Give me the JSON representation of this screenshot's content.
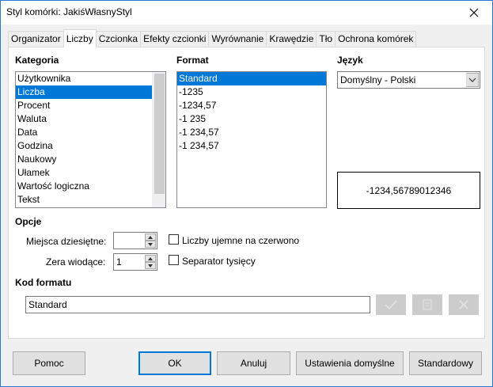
{
  "window": {
    "title": "Styl komórki: JakiśWłasnyStyl"
  },
  "tabs": [
    {
      "label": "Organizator"
    },
    {
      "label": "Liczby",
      "active": true
    },
    {
      "label": "Czcionka"
    },
    {
      "label": "Efekty czcionki"
    },
    {
      "label": "Wyrównanie"
    },
    {
      "label": "Krawędzie"
    },
    {
      "label": "Tło"
    },
    {
      "label": "Ochrona komórek"
    }
  ],
  "category": {
    "label": "Kategoria",
    "items": [
      "Użytkownika",
      "Liczba",
      "Procent",
      "Waluta",
      "Data",
      "Godzina",
      "Naukowy",
      "Ułamek",
      "Wartość logiczna",
      "Tekst"
    ],
    "selected": "Liczba"
  },
  "format": {
    "label": "Format",
    "items": [
      "Standard",
      "-1235",
      "-1234,57",
      "-1 235",
      "-1 234,57",
      "-1 234,57"
    ],
    "selected": "Standard"
  },
  "language": {
    "label": "Język",
    "value": "Domyślny - Polski"
  },
  "preview": {
    "value": "-1234,56789012346"
  },
  "options": {
    "label": "Opcje",
    "decimal_places_label": "Miejsca dziesiętne:",
    "decimal_places_value": "",
    "leading_zeros_label": "Zera wiodące:",
    "leading_zeros_value": "1",
    "negative_red_label": "Liczby ujemne na czerwono",
    "negative_red_checked": false,
    "thousands_sep_label": "Separator tysięcy",
    "thousands_sep_checked": false
  },
  "format_code": {
    "label": "Kod formatu",
    "value": "Standard"
  },
  "buttons": {
    "help": "Pomoc",
    "ok": "OK",
    "cancel": "Anuluj",
    "reset_defaults": "Ustawienia domyślne",
    "standard": "Standardowy"
  },
  "colors": {
    "selection": "#0078d7",
    "default_button_border": "#0078d7"
  }
}
